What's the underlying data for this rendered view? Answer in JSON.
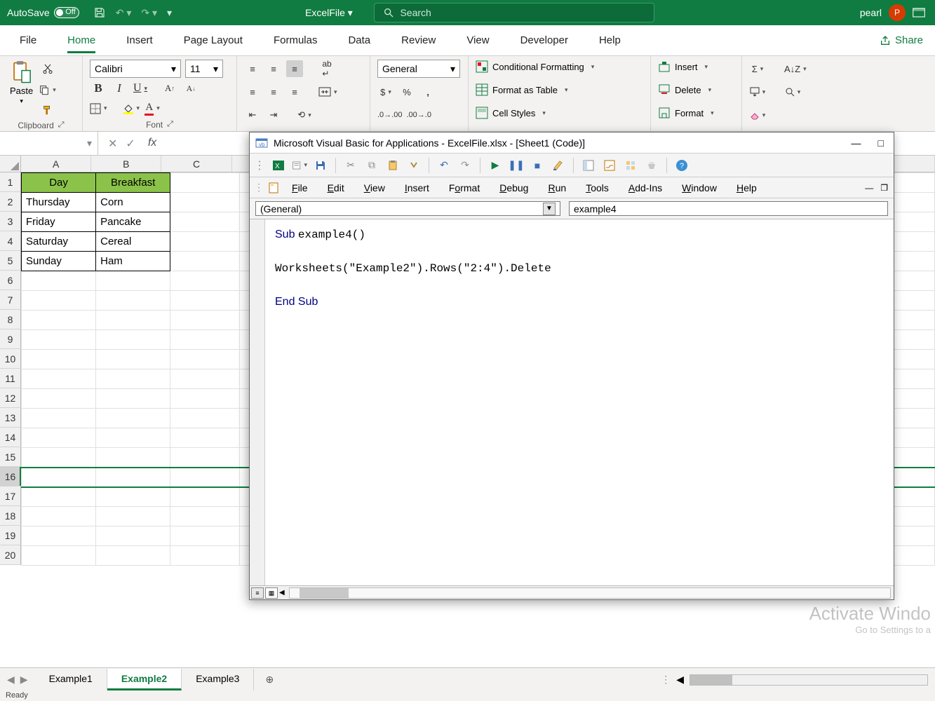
{
  "title_bar": {
    "autosave_label": "AutoSave",
    "autosave_state": "Off",
    "file_name": "ExcelFile",
    "search_placeholder": "Search",
    "user_name": "pearl",
    "user_initial": "P"
  },
  "ribbon_tabs": [
    "File",
    "Home",
    "Insert",
    "Page Layout",
    "Formulas",
    "Data",
    "Review",
    "View",
    "Developer",
    "Help"
  ],
  "ribbon_active": "Home",
  "share_label": "Share",
  "ribbon": {
    "clipboard_label": "Clipboard",
    "paste_label": "Paste",
    "font_name": "Calibri",
    "font_size": "11",
    "font_label": "Font",
    "number_format": "General",
    "cond_fmt": "Conditional Formatting",
    "fmt_table": "Format as Table",
    "cell_styles": "Cell Styles",
    "insert": "Insert",
    "delete": "Delete",
    "format": "Format"
  },
  "formula_bar": {
    "name_box": "",
    "fx": "fx"
  },
  "columns": [
    "A",
    "B",
    "C"
  ],
  "rows_visible": 20,
  "selected_row": 16,
  "table": {
    "headers": [
      "Day",
      "Breakfast"
    ],
    "rows": [
      [
        "Thursday",
        "Corn"
      ],
      [
        "Friday",
        "Pancake"
      ],
      [
        "Saturday",
        "Cereal"
      ],
      [
        "Sunday",
        "Ham"
      ]
    ]
  },
  "sheet_tabs": [
    "Example1",
    "Example2",
    "Example3"
  ],
  "sheet_active": "Example2",
  "watermark_line1": "Activate Windo",
  "watermark_line2": "Go to Settings to a",
  "status_text": "Ready",
  "vba": {
    "title": "Microsoft Visual Basic for Applications - ExcelFile.xlsx - [Sheet1 (Code)]",
    "menus_html": [
      "<u>F</u>ile",
      "<u>E</u>dit",
      "<u>V</u>iew",
      "<u>I</u>nsert",
      "F<u>o</u>rmat",
      "<u>D</u>ebug",
      "<u>R</u>un",
      "<u>T</u>ools",
      "<u>A</u>dd-Ins",
      "<u>W</u>indow",
      "<u>H</u>elp"
    ],
    "dd_left": "(General)",
    "dd_right": "example4",
    "code_lines": [
      {
        "t": "kw",
        "v": "Sub "
      },
      {
        "t": "id",
        "v": "example4()"
      },
      {
        "t": "nl"
      },
      {
        "t": "nl"
      },
      {
        "t": "id",
        "v": "Worksheets(\"Example2\").Rows(\"2:4\").Delete"
      },
      {
        "t": "nl"
      },
      {
        "t": "nl"
      },
      {
        "t": "kw",
        "v": "End Sub"
      }
    ]
  }
}
